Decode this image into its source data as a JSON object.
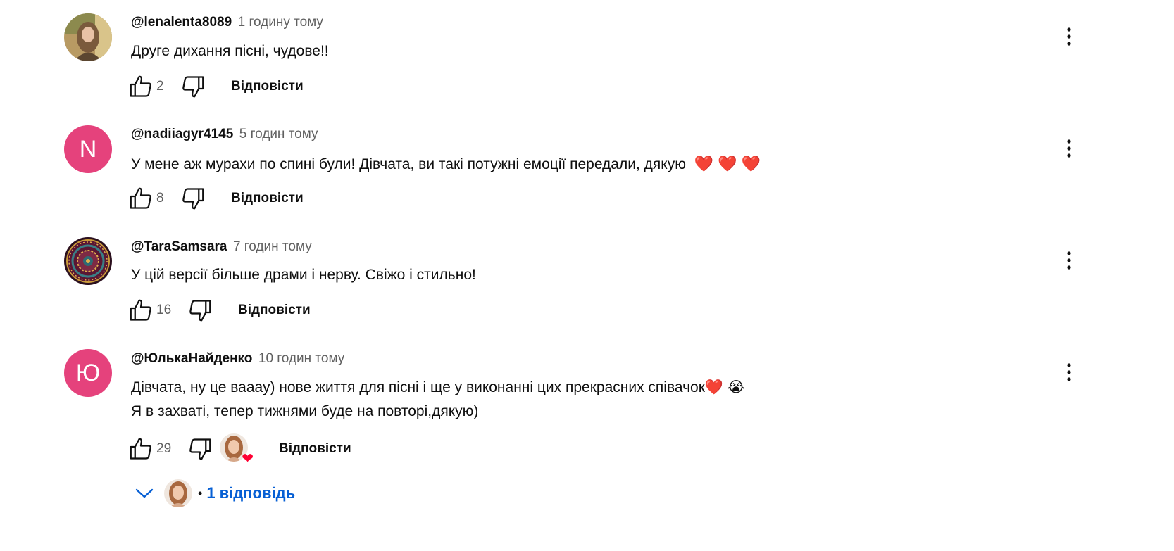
{
  "comments": [
    {
      "author": "@lenalenta8089",
      "time": "1 годину тому",
      "lines": [
        "Друге дихання пісні, чудове!!"
      ],
      "likes": "2",
      "reply_label": "Відповісти",
      "avatar_type": "photo"
    },
    {
      "author": "@nadiiagyr4145",
      "time": "5 годин тому",
      "lines": [
        "У мене аж мурахи по спині були! Дівчата, ви такі потужні емоції передали, дякую"
      ],
      "hearts": "❤️ ❤️ ❤️",
      "likes": "8",
      "reply_label": "Відповісти",
      "avatar_letter": "N",
      "avatar_color": "#e5427c"
    },
    {
      "author": "@TaraSamsara",
      "time": "7 годин тому",
      "lines": [
        "У цій версії більше драми і нерву. Свіжо і стильно!"
      ],
      "likes": "16",
      "reply_label": "Відповісти",
      "avatar_type": "mandala"
    },
    {
      "author": "@ЮлькаНайденко",
      "time": "10 годин тому",
      "lines": [
        "Дівчата, ну це вааау) нове життя для пісні і ще у виконанні цих прекрасних співачок❤️ 😭",
        "Я в захваті, тепер тижнями буде на повторі,дякую)"
      ],
      "likes": "29",
      "reply_label": "Відповісти",
      "avatar_letter": "Ю",
      "avatar_color": "#e5427c",
      "creator_heart": "❤"
    }
  ],
  "replies": {
    "label": "1 відповідь",
    "separator": "•"
  },
  "icons": {
    "like": "thumb-up-icon",
    "dislike": "thumb-down-icon",
    "menu": "more-vert-icon",
    "expand": "chevron-down-icon"
  },
  "colors": {
    "link": "#065fd4",
    "letter_avatar": "#e5427c",
    "secondary_text": "#606060"
  }
}
